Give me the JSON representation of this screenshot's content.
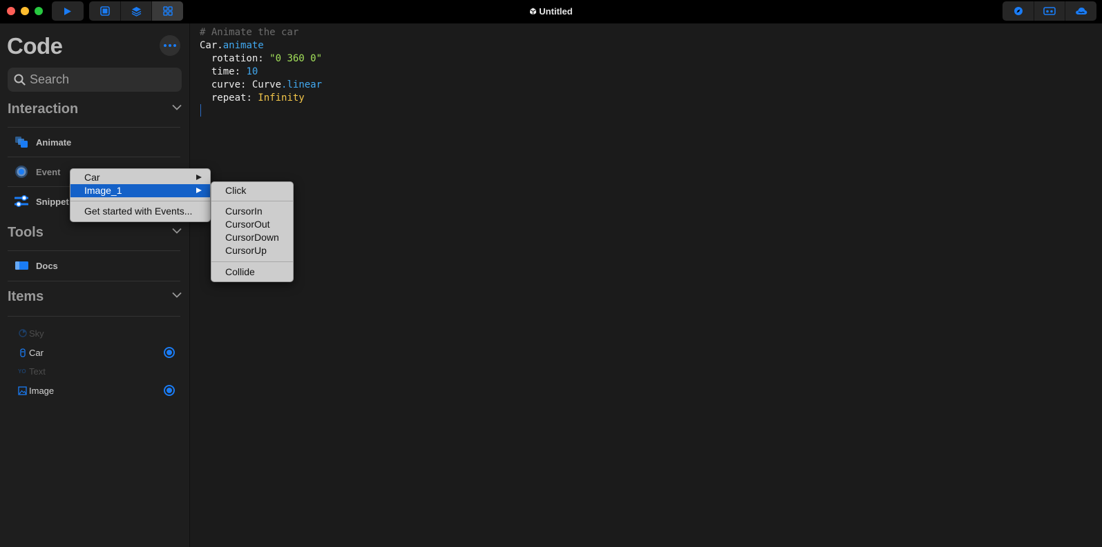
{
  "titlebar": {
    "title": "Untitled",
    "traffic_colors": [
      "#fe5f57",
      "#febc2e",
      "#28c840"
    ],
    "toolbar_icons": [
      "play-icon",
      "square-icon",
      "layers-icon",
      "grid-icon"
    ],
    "right_icons": [
      "compass-icon",
      "vr-headset-icon",
      "cloud-icon"
    ]
  },
  "sidebar": {
    "heading": "Code",
    "search_placeholder": "Search",
    "sections": {
      "interaction": "Interaction",
      "tools": "Tools",
      "items": "Items"
    },
    "interaction_items": [
      {
        "label": "Animate",
        "icon": "animate-icon"
      },
      {
        "label": "Event",
        "icon": "event-icon"
      },
      {
        "label": "Snippet",
        "icon": "snippet-icon"
      }
    ],
    "tools_items": [
      {
        "label": "Docs",
        "icon": "docs-icon"
      }
    ],
    "scene_items": [
      {
        "label": "Sky",
        "icon": "sky-icon",
        "active": false
      },
      {
        "label": "Car",
        "icon": "car-icon",
        "active": true
      },
      {
        "label": "Text",
        "icon": "text-icon",
        "active": false
      },
      {
        "label": "Image",
        "icon": "image-icon",
        "active": true
      }
    ]
  },
  "editor": {
    "lines": [
      [
        {
          "t": "# Animate the car",
          "c": "#6d6d6d"
        }
      ],
      [
        {
          "t": "Car",
          "c": "#ececec"
        },
        {
          "t": ".",
          "c": "#ececec"
        },
        {
          "t": "animate",
          "c": "#41a8f0"
        }
      ],
      [
        {
          "t": "  rotation",
          "c": "#ececec"
        },
        {
          "t": ": ",
          "c": "#ececec"
        },
        {
          "t": "\"0 360 0\"",
          "c": "#a3e05a"
        }
      ],
      [
        {
          "t": "  time",
          "c": "#ececec"
        },
        {
          "t": ": ",
          "c": "#ececec"
        },
        {
          "t": "10",
          "c": "#41a8f0"
        }
      ],
      [
        {
          "t": "  curve",
          "c": "#ececec"
        },
        {
          "t": ": Curve",
          "c": "#ececec"
        },
        {
          "t": ".linear",
          "c": "#41a8f0"
        }
      ],
      [
        {
          "t": "  repeat",
          "c": "#ececec"
        },
        {
          "t": ": ",
          "c": "#ececec"
        },
        {
          "t": "Infinity",
          "c": "#f3c64a"
        }
      ]
    ]
  },
  "context_menu": {
    "items": [
      "Car",
      "Image_1",
      "Get started with Events..."
    ],
    "highlighted": "Image_1"
  },
  "submenu": {
    "group1": [
      "Click"
    ],
    "group2": [
      "CursorIn",
      "CursorOut",
      "CursorDown",
      "CursorUp"
    ],
    "group3": [
      "Collide"
    ]
  },
  "colors": {
    "accent": "#1a7cf5",
    "highlight": "#1461c8"
  }
}
